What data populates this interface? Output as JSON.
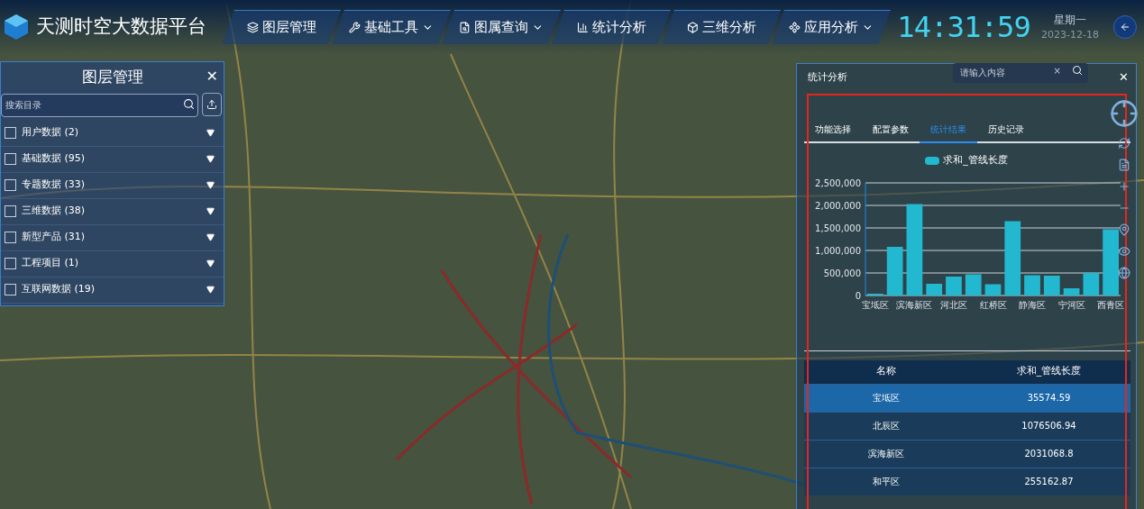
{
  "header": {
    "title": "天测时空大数据平台",
    "nav": [
      {
        "label": "图层管理",
        "dropdown": false
      },
      {
        "label": "基础工具",
        "dropdown": true
      },
      {
        "label": "图属查询",
        "dropdown": true
      },
      {
        "label": "统计分析",
        "dropdown": false
      },
      {
        "label": "三维分析",
        "dropdown": false
      },
      {
        "label": "应用分析",
        "dropdown": true
      }
    ],
    "time": "14:31:59",
    "weekday": "星期一",
    "date": "2023-12-18"
  },
  "map_search": {
    "placeholder": "请输入内容",
    "clear": "×"
  },
  "layer_panel": {
    "title": "图层管理",
    "close": "✕",
    "search": {
      "placeholder": "搜索目录"
    },
    "items": [
      {
        "label": "用户数据 (2)",
        "checked": false
      },
      {
        "label": "基础数据 (95)",
        "checked": false
      },
      {
        "label": "专题数据 (33)",
        "checked": false
      },
      {
        "label": "三维数据 (38)",
        "checked": false
      },
      {
        "label": "新型产品 (31)",
        "checked": false
      },
      {
        "label": "工程项目 (1)",
        "checked": false
      },
      {
        "label": "互联网数据 (19)",
        "checked": false
      }
    ]
  },
  "stats_panel": {
    "title": "统计分析",
    "close": "✕",
    "tabs": [
      {
        "label": "功能选择",
        "selected": false
      },
      {
        "label": "配置参数",
        "selected": false
      },
      {
        "label": "统计结果",
        "selected": true
      },
      {
        "label": "历史记录",
        "selected": false
      }
    ],
    "chart_data": {
      "type": "bar",
      "categories": [
        "宝坻区",
        null,
        "滨海新区",
        null,
        "河北区",
        null,
        "红桥区",
        null,
        "静海区",
        null,
        "宁河区",
        null,
        "西青区"
      ],
      "series": [
        {
          "name": "求和_管线长度",
          "color": "#22b8cf",
          "values": [
            40000,
            1080000,
            2030000,
            260000,
            420000,
            470000,
            250000,
            1650000,
            450000,
            440000,
            160000,
            500000,
            1470000
          ]
        }
      ],
      "ylim": [
        0,
        2500000
      ],
      "yticks": [
        0,
        {
          "value": 500000,
          "label": "500,000"
        },
        {
          "value": 1000000,
          "label": "1,000,000"
        },
        {
          "value": 1500000,
          "label": "1,500,000"
        },
        {
          "value": 2000000,
          "label": "2,000,000"
        },
        {
          "value": 2500000,
          "label": "2,500,000"
        }
      ],
      "grid": true
    },
    "table": {
      "columns": [
        "名称",
        "求和_管线长度"
      ],
      "rows": [
        {
          "cells": [
            "宝坻区",
            "35574.59"
          ],
          "selected": true
        },
        {
          "cells": [
            "北辰区",
            "1076506.94"
          ],
          "selected": false
        },
        {
          "cells": [
            "滨海新区",
            "2031068.8"
          ],
          "selected": false
        },
        {
          "cells": [
            "和平区",
            "255162.87"
          ],
          "selected": false
        }
      ]
    }
  }
}
